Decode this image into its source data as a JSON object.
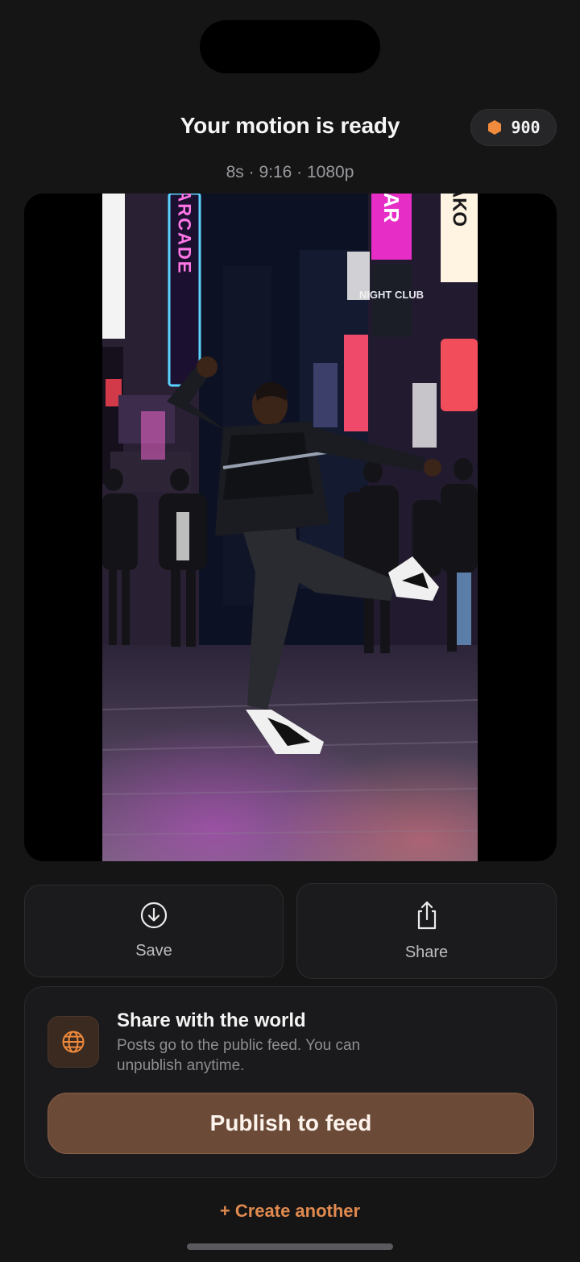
{
  "header": {
    "title": "Your motion is ready",
    "credits": "900",
    "meta": "8s · 9:16 · 1080p"
  },
  "video": {
    "signs": {
      "neon_arcade": "NEON ARCADE",
      "bar": "BAR",
      "tako": "TAKO",
      "night_club": "NIGHT CLUB"
    }
  },
  "actions": {
    "save_label": "Save",
    "share_label": "Share"
  },
  "world": {
    "title": "Share with the world",
    "desc_line1": "Posts go to the public feed. You can",
    "desc_line2": "unpublish anytime.",
    "publish_label": "Publish to feed"
  },
  "footer": {
    "create_another": "+ Create another"
  },
  "colors": {
    "background": "#151516",
    "accent": "#e08a4f",
    "publish_button": "#6b4a37",
    "credit_icon": "#f08a3c"
  },
  "icons": {
    "credits": "hexagon-icon",
    "save": "download-circle-icon",
    "share": "share-icon",
    "world": "globe-icon"
  }
}
